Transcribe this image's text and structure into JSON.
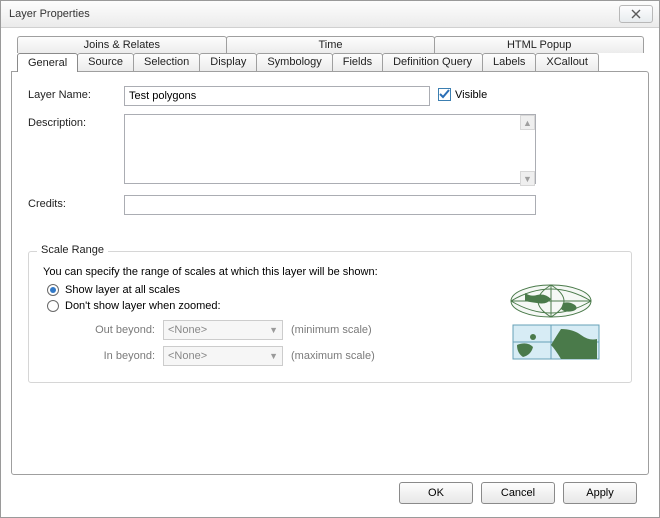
{
  "window": {
    "title": "Layer Properties"
  },
  "tabs": {
    "row1": [
      {
        "label": "Joins & Relates"
      },
      {
        "label": "Time"
      },
      {
        "label": "HTML Popup"
      }
    ],
    "row2": [
      {
        "label": "General",
        "active": true
      },
      {
        "label": "Source"
      },
      {
        "label": "Selection"
      },
      {
        "label": "Display"
      },
      {
        "label": "Symbology"
      },
      {
        "label": "Fields"
      },
      {
        "label": "Definition Query"
      },
      {
        "label": "Labels"
      },
      {
        "label": "XCallout"
      }
    ]
  },
  "general": {
    "layer_name_label": "Layer Name:",
    "layer_name_value": "Test polygons",
    "visible_label": "Visible",
    "visible_checked": true,
    "description_label": "Description:",
    "description_value": "",
    "credits_label": "Credits:",
    "credits_value": ""
  },
  "scale_range": {
    "title": "Scale Range",
    "intro": "You can specify the range of scales at which this layer will be shown:",
    "opt_all": "Show layer at all scales",
    "opt_zoom": "Don't show layer when zoomed:",
    "selected": "all",
    "out_label": "Out beyond:",
    "out_value": "<None>",
    "out_hint": "(minimum scale)",
    "in_label": "In beyond:",
    "in_value": "<None>",
    "in_hint": "(maximum scale)"
  },
  "buttons": {
    "ok": "OK",
    "cancel": "Cancel",
    "apply": "Apply"
  }
}
